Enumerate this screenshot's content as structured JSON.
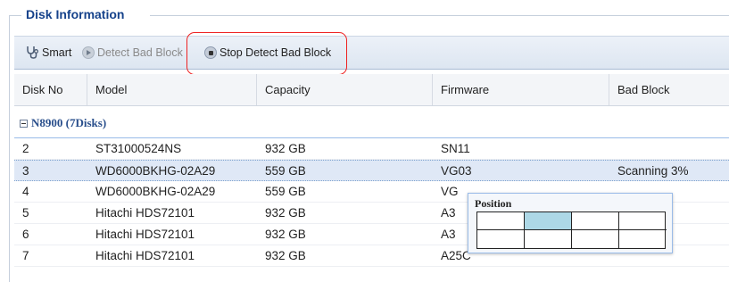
{
  "section_title": "Disk Information",
  "toolbar": {
    "smart_label": "Smart",
    "detect_label": "Detect Bad Block",
    "stop_label": "Stop Detect Bad Block",
    "smart_icon": "stethoscope-icon",
    "detect_icon": "play-circle-icon",
    "stop_icon": "stop-circle-icon",
    "highlight_color": "#ee2222"
  },
  "table": {
    "columns": [
      "Disk No",
      "Model",
      "Capacity",
      "Firmware",
      "Bad Block"
    ],
    "group_label": "N8900 (7Disks)",
    "rows": [
      {
        "disk_no": "2",
        "model": "ST31000524NS",
        "capacity": "932 GB",
        "firmware": "SN11",
        "bad_block": ""
      },
      {
        "disk_no": "3",
        "model": "WD6000BKHG-02A29",
        "capacity": "559 GB",
        "firmware": "VG03",
        "bad_block": "Scanning 3%"
      },
      {
        "disk_no": "4",
        "model": "WD6000BKHG-02A29",
        "capacity": "559 GB",
        "firmware": "VG",
        "bad_block": ""
      },
      {
        "disk_no": "5",
        "model": "Hitachi HDS72101",
        "capacity": "932 GB",
        "firmware": "A3",
        "bad_block": ""
      },
      {
        "disk_no": "6",
        "model": "Hitachi HDS72101",
        "capacity": "932 GB",
        "firmware": "A3",
        "bad_block": ""
      },
      {
        "disk_no": "7",
        "model": "Hitachi HDS72101",
        "capacity": "932 GB",
        "firmware": "A25C",
        "bad_block": ""
      }
    ],
    "selected_row": 1
  },
  "position_popup": {
    "title": "Position",
    "rows": 2,
    "cols": 4,
    "active_cell": {
      "row": 0,
      "col": 1
    },
    "active_color": "#add8e6"
  }
}
